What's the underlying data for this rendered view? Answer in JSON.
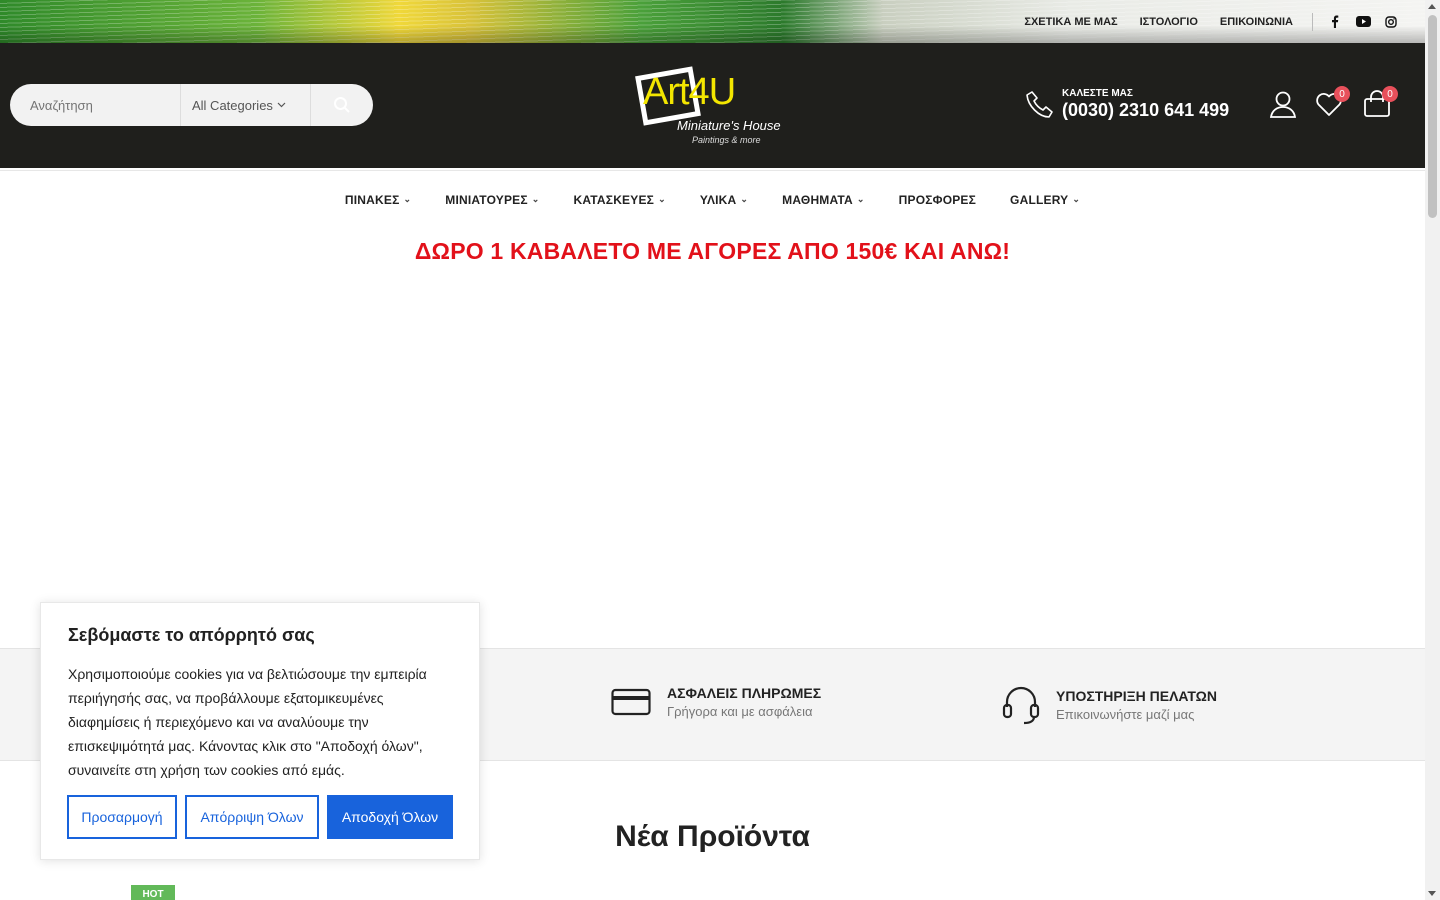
{
  "topbar": {
    "links": [
      "ΣΧΕΤΙΚΑ ΜΕ ΜΑΣ",
      "ΙΣΤΟΛΟΓΙΟ",
      "ΕΠΙΚΟΙΝΩΝΙΑ"
    ],
    "social_icons": [
      "facebook-icon",
      "youtube-icon",
      "instagram-icon"
    ]
  },
  "search": {
    "placeholder": "Αναζήτηση",
    "category": "All Categories"
  },
  "logo": {
    "brand": "Art4U",
    "line1": "Miniature's House",
    "line2": "Paintings & more"
  },
  "contact": {
    "label": "ΚΑΛΕΣΤΕ ΜΑΣ",
    "phone": "(0030) 2310 641 499"
  },
  "header_icons": {
    "wishlist_count": "0",
    "cart_count": "0"
  },
  "nav": {
    "items": [
      {
        "label": "ΠΙΝΑΚΕΣ",
        "dropdown": true
      },
      {
        "label": "ΜΙΝΙΑΤΟΥΡΕΣ",
        "dropdown": true
      },
      {
        "label": "ΚΑΤΑΣΚΕΥΕΣ",
        "dropdown": true
      },
      {
        "label": "ΥΛΙΚΑ",
        "dropdown": true
      },
      {
        "label": "ΜΑΘΗΜΑΤΑ",
        "dropdown": true
      },
      {
        "label": "ΠΡΟΣΦΟΡΕΣ",
        "dropdown": false
      },
      {
        "label": "GALLERY",
        "dropdown": true
      }
    ]
  },
  "promo": "ΔΩΡΟ 1 ΚΑΒΑΛΕΤΟ ΜΕ ΑΓΟΡΕΣ ΑΠΟ 150€ ΚΑΙ ΑΝΩ!",
  "features": [
    {
      "title": "ΑΣΦΑΛΕΙΣ ΠΛΗΡΩΜΕΣ",
      "desc": "Γρήγορα και με ασφάλεια",
      "icon": "credit-card-icon"
    },
    {
      "title": "ΥΠΟΣΤΗΡΙΞΗ ΠΕΛΑΤΩΝ",
      "desc": "Επικοινωνήστε μαζί μας",
      "icon": "headset-icon"
    }
  ],
  "new_products": {
    "title": "Νέα Προϊόντα",
    "badge": "HOT"
  },
  "cookie": {
    "title": "Σεβόμαστε το απόρρητό σας",
    "body": "Χρησιμοποιούμε cookies για να βελτιώσουμε την εμπειρία περιήγησής σας, να προβάλλουμε εξατομικευμένες διαφημίσεις ή περιεχόμενο και να αναλύουμε την επισκεψιμότητά μας. Κάνοντας κλικ στο \"Αποδοχή όλων\", συναινείτε στη χρήση των cookies από εμάς.",
    "customize": "Προσαρμογή",
    "reject": "Απόρριψη Όλων",
    "accept": "Αποδοχή Όλων"
  },
  "colors": {
    "header_bg": "#1f1f1c",
    "promo": "#e2111a",
    "cookie_accent": "#1863dc",
    "badge": "#e8505b",
    "hot": "#62b959"
  }
}
